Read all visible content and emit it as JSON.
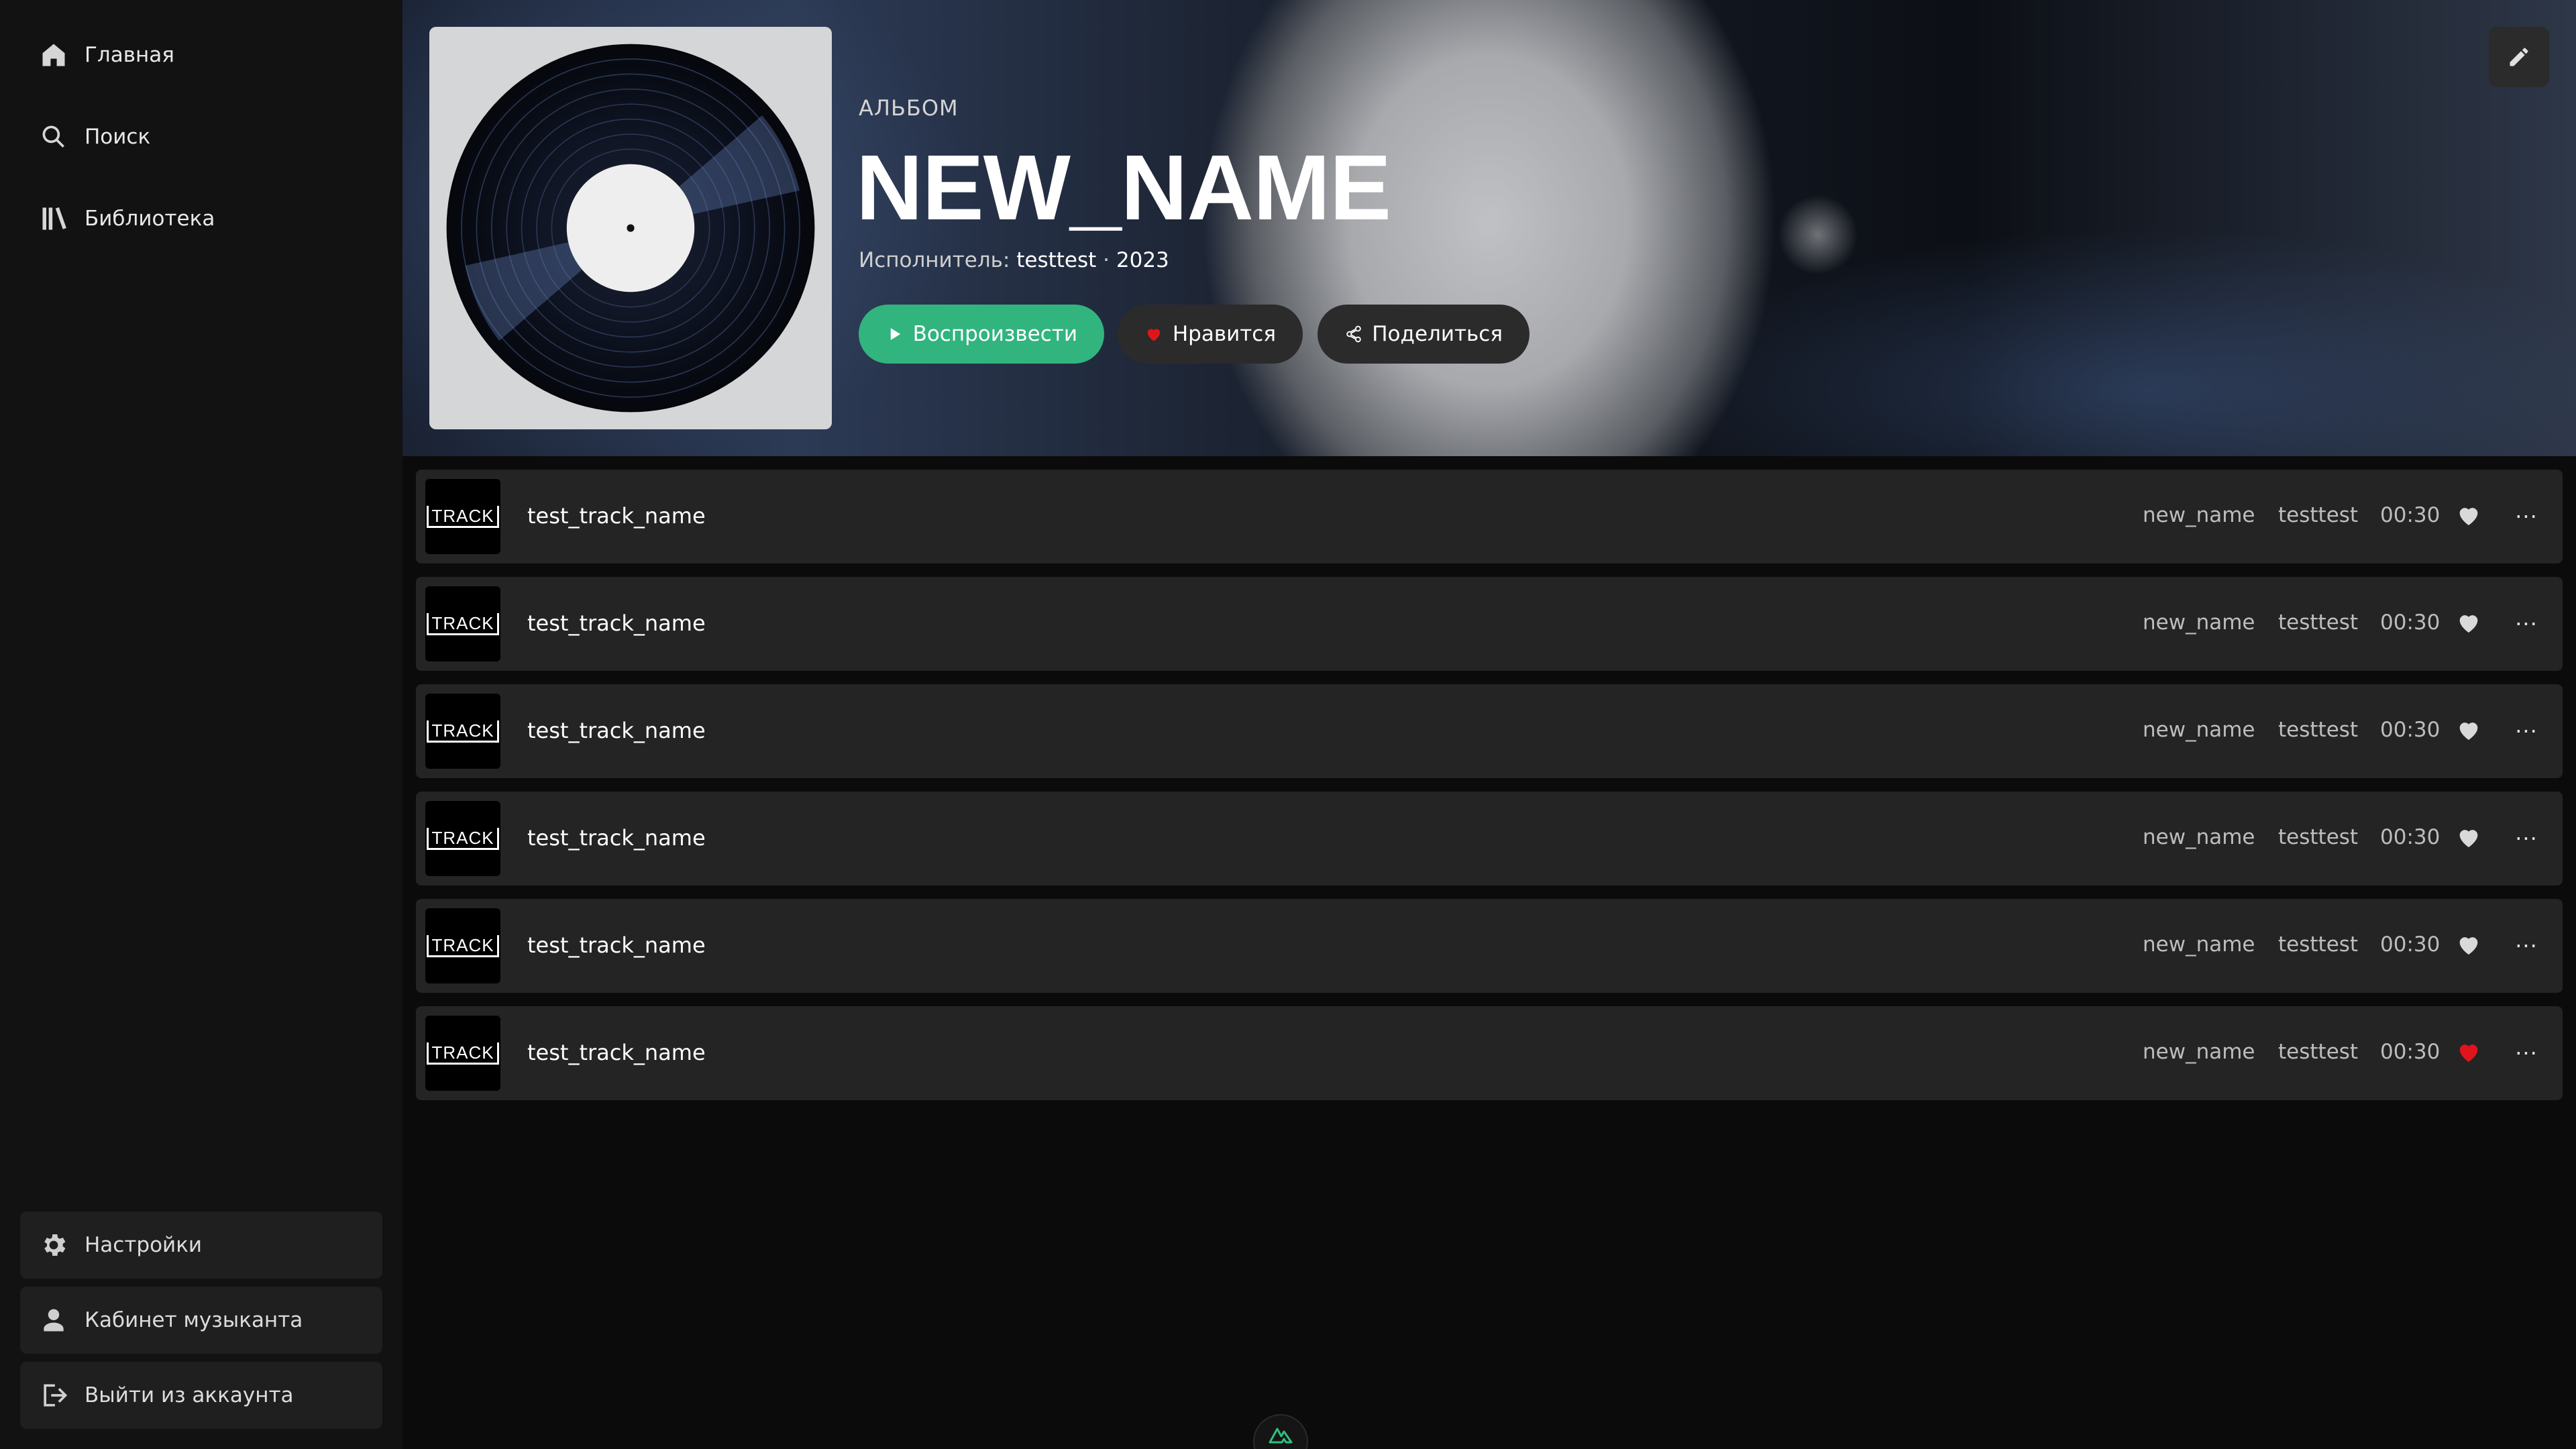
{
  "sidebar": {
    "nav": [
      {
        "label": "Главная",
        "icon": "home-icon"
      },
      {
        "label": "Поиск",
        "icon": "search-icon"
      },
      {
        "label": "Библиотека",
        "icon": "library-icon"
      }
    ],
    "bottom": [
      {
        "label": "Настройки",
        "icon": "gear-icon"
      },
      {
        "label": "Кабинет музыканта",
        "icon": "user-icon"
      },
      {
        "label": "Выйти из аккаунта",
        "icon": "logout-icon"
      }
    ]
  },
  "album": {
    "type": "АЛЬБОМ",
    "title": "NEW_NAME",
    "artist_prefix": "Исполнитель:",
    "artist": "testtest",
    "separator": "·",
    "year": "2023",
    "buttons": {
      "play": "Воспроизвести",
      "like": "Нравится",
      "share": "Поделиться"
    }
  },
  "tracks": [
    {
      "thumb": "TRACK",
      "name": "test_track_name",
      "album": "new_name",
      "artist": "testtest",
      "duration": "00:30",
      "liked": false
    },
    {
      "thumb": "TRACK",
      "name": "test_track_name",
      "album": "new_name",
      "artist": "testtest",
      "duration": "00:30",
      "liked": false
    },
    {
      "thumb": "TRACK",
      "name": "test_track_name",
      "album": "new_name",
      "artist": "testtest",
      "duration": "00:30",
      "liked": false
    },
    {
      "thumb": "TRACK",
      "name": "test_track_name",
      "album": "new_name",
      "artist": "testtest",
      "duration": "00:30",
      "liked": false
    },
    {
      "thumb": "TRACK",
      "name": "test_track_name",
      "album": "new_name",
      "artist": "testtest",
      "duration": "00:30",
      "liked": false
    },
    {
      "thumb": "TRACK",
      "name": "test_track_name",
      "album": "new_name",
      "artist": "testtest",
      "duration": "00:30",
      "liked": true
    }
  ],
  "colors": {
    "accent": "#32b47f",
    "like": "#e0141c",
    "heart_inactive": "#d9d9d9",
    "track_bg": "#242424",
    "sidebar_bg": "#121212"
  }
}
